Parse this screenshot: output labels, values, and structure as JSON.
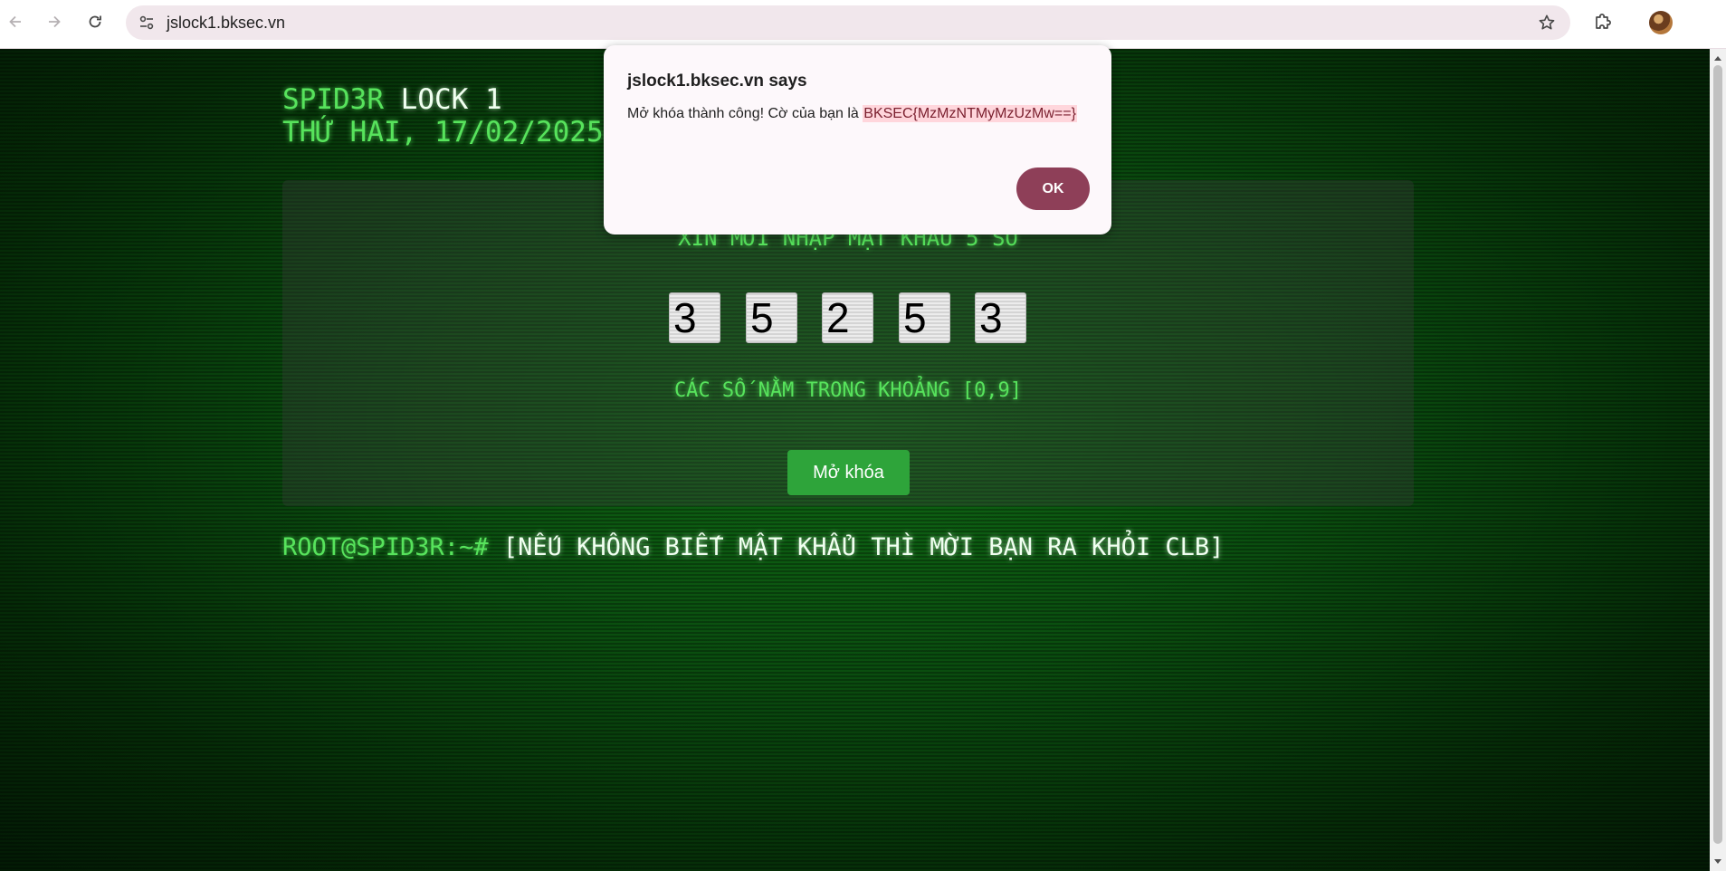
{
  "browser": {
    "url": "jslock1.bksec.vn",
    "icons": {
      "back": "arrow-left-icon",
      "forward": "arrow-right-icon",
      "reload": "reload-icon",
      "site_info": "tune-icon",
      "bookmark": "star-icon",
      "extensions": "puzzle-icon",
      "profile": "avatar"
    }
  },
  "page": {
    "title_part1": "SPID3R",
    "title_part2": "LOCK 1",
    "date": "THỨ HAI, 17/02/2025",
    "prompt": "XIN MỜI NHẬP MẬT KHẨU 5 SỐ",
    "digits": [
      "3",
      "5",
      "2",
      "5",
      "3"
    ],
    "range_hint": "CÁC SỐ NẰM TRONG KHOẢNG [0,9]",
    "unlock_button": "Mở khóa",
    "terminal_prompt": "ROOT@SPID3R:~#",
    "terminal_message": "[NẾU KHÔNG BIẾT MẬT KHẨU THÌ MỜI BẠN RA KHỎI CLB]",
    "colors": {
      "terminal_green": "#57e35c",
      "button_green": "#2ea43a"
    }
  },
  "dialog": {
    "title": "jslock1.bksec.vn says",
    "message": "Mở khóa thành công! Cờ của bạn là",
    "flag": "BKSEC{MzMzNTMyMzUzMw==}",
    "ok_label": "OK",
    "colors": {
      "ok_button": "#8e3f58"
    }
  }
}
